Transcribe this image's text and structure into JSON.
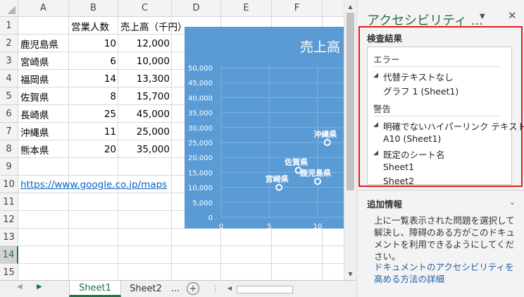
{
  "columns": [
    "A",
    "B",
    "C",
    "D",
    "E",
    "F"
  ],
  "rows": [
    "1",
    "2",
    "3",
    "4",
    "5",
    "6",
    "7",
    "8",
    "9",
    "10",
    "11",
    "12",
    "13",
    "14",
    "15"
  ],
  "selected_row": "14",
  "cells": {
    "B1": "営業人数",
    "C1": "売上高（千円）",
    "A2": "鹿児島県",
    "B2": "10",
    "C2": "12,000",
    "A3": "宮崎県",
    "B3": "6",
    "C3": "10,000",
    "A4": "福岡県",
    "B4": "14",
    "C4": "13,300",
    "A5": "佐賀県",
    "B5": "8",
    "C5": "15,700",
    "A6": "長崎県",
    "B6": "25",
    "C6": "45,000",
    "A7": "沖縄県",
    "B7": "11",
    "C7": "25,000",
    "A8": "熊本県",
    "B8": "20",
    "C8": "35,000",
    "A10": "https://www.google.co.jp/maps"
  },
  "tabs": {
    "sheet1": "Sheet1",
    "sheet2": "Sheet2",
    "more": "...",
    "add": "+"
  },
  "chart_data": {
    "type": "scatter",
    "title": "売上高",
    "y_ticks": [
      "50,000",
      "45,000",
      "40,000",
      "35,000",
      "30,000",
      "25,000",
      "20,000",
      "15,000",
      "10,000",
      "5,000",
      "0"
    ],
    "x_ticks": [
      "0",
      "5",
      "10"
    ],
    "xlim": [
      0,
      12.7
    ],
    "ylim": [
      0,
      50000
    ],
    "points": [
      {
        "label": "宮崎県",
        "x": 6,
        "y": 10000
      },
      {
        "label": "佐賀県",
        "x": 8,
        "y": 15700
      },
      {
        "label": "鹿児島県",
        "x": 10,
        "y": 12000
      },
      {
        "label": "沖縄県",
        "x": 11,
        "y": 25000
      }
    ],
    "grid": true
  },
  "pane": {
    "title": "アクセシビリティ ...",
    "results_heading": "検査結果",
    "error_category": "エラー",
    "error_group": "代替テキストなし",
    "error_item": "グラフ 1 (Sheet1)",
    "warning_category": "警告",
    "warning_group1": "明確でないハイパーリンク テキスト",
    "warning_item1": "A10 (Sheet1)",
    "warning_group2": "既定のシート名",
    "warning_item2a": "Sheet1",
    "warning_item2b": "Sheet2",
    "info_heading": "追加情報",
    "info_text": "上に一覧表示された問題を選択して解決し、障碍のある方がこのドキュメントを利用できるようにしてください。",
    "help_link": "ドキュメントのアクセシビリティを高める方法の詳細"
  },
  "colors": {
    "excel_green": "#217346",
    "chart_bg": "#5b9bd5",
    "alert_red": "#e31b1b"
  }
}
